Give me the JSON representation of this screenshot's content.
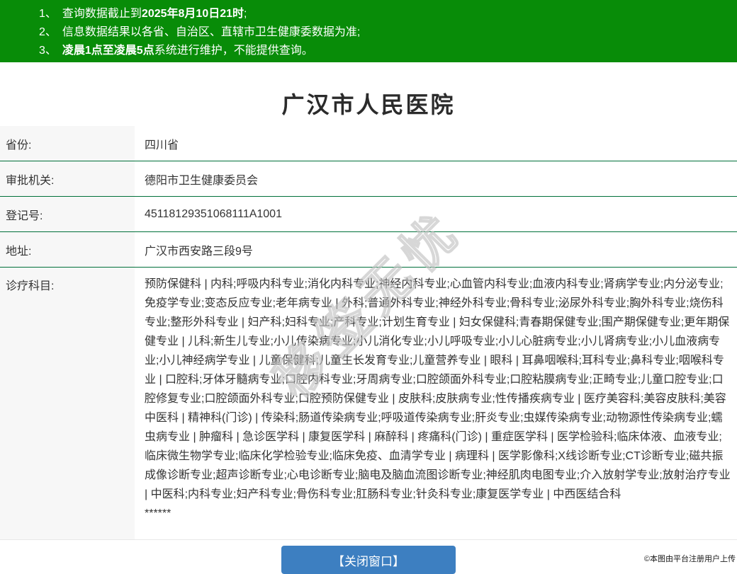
{
  "notices": {
    "items": [
      {
        "num": "1、",
        "pre": "查询数据截止到",
        "bold": "2025年8月10日21时",
        "post": ";"
      },
      {
        "num": "2、",
        "pre": "信息数据结果以各省、自治区、直辖市卫生健康委数据为准;",
        "bold": "",
        "post": ""
      },
      {
        "num": "3、",
        "pre": "",
        "bold": "凌晨1点至凌晨5点",
        "post": "系统进行维护，不能提供查询。"
      }
    ]
  },
  "page": {
    "title": "广汉市人民医院"
  },
  "info": {
    "rows": [
      {
        "label": "省份:",
        "value": "四川省"
      },
      {
        "label": "审批机关:",
        "value": "德阳市卫生健康委员会"
      },
      {
        "label": "登记号:",
        "value": "45118129351068111A1001"
      },
      {
        "label": "地址:",
        "value": "广汉市西安路三段9号"
      }
    ]
  },
  "subjects": {
    "label": "诊疗科目:",
    "text": "预防保健科 | 内科;呼吸内科专业;消化内科专业;神经内科专业;心血管内科专业;血液内科专业;肾病学专业;内分泌专业;免疫学专业;变态反应专业;老年病专业 | 外科;普通外科专业;神经外科专业;骨科专业;泌尿外科专业;胸外科专业;烧伤科专业;整形外科专业 | 妇产科;妇科专业;产科专业;计划生育专业 | 妇女保健科;青春期保健专业;围产期保健专业;更年期保健专业 | 儿科;新生儿专业;小儿传染病专业;小儿消化专业;小儿呼吸专业;小儿心脏病专业;小儿肾病专业;小儿血液病专业;小儿神经病学专业 | 儿童保健科;儿童生长发育专业;儿童营养专业 | 眼科 | 耳鼻咽喉科;耳科专业;鼻科专业;咽喉科专业 | 口腔科;牙体牙髓病专业;口腔内科专业;牙周病专业;口腔颌面外科专业;口腔粘膜病专业;正畸专业;儿童口腔专业;口腔修复专业;口腔颌面外科专业;口腔预防保健专业 | 皮肤科;皮肤病专业;性传播疾病专业 | 医疗美容科;美容皮肤科;美容中医科 | 精神科(门诊) | 传染科;肠道传染病专业;呼吸道传染病专业;肝炎专业;虫媒传染病专业;动物源性传染病专业;蠕虫病专业 | 肿瘤科 | 急诊医学科 | 康复医学科 | 麻醉科 | 疼痛科(门诊) | 重症医学科 | 医学检验科;临床体液、血液专业;临床微生物学专业;临床化学检验专业;临床免疫、血清学专业 | 病理科 | 医学影像科;X线诊断专业;CT诊断专业;磁共振成像诊断专业;超声诊断专业;心电诊断专业;脑电及脑血流图诊断专业;神经肌肉电图专业;介入放射学专业;放射治疗专业 | 中医科;内科专业;妇产科专业;骨伤科专业;肛肠科专业;针灸科专业;康复医学专业 | 中西医结合科",
    "redacted": "******"
  },
  "watermark": {
    "text": "移签无忧"
  },
  "footer": {
    "close_button": "【关闭窗口】",
    "attribution": "©本图由平台注册用户上传"
  },
  "colors": {
    "header_green": "#088c08",
    "divider_green": "#00703a",
    "label_bg": "#f7f7f7",
    "button_blue": "#3d7fc1",
    "text": "#333333"
  }
}
